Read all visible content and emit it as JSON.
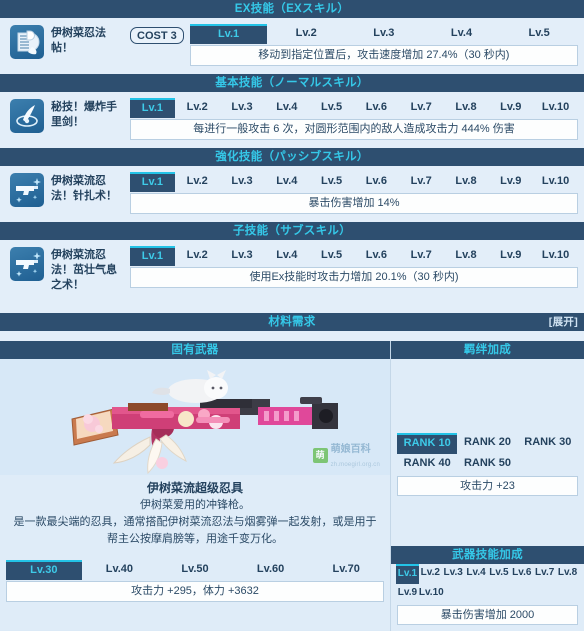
{
  "sections": {
    "ex": {
      "title": "EX技能（EXスキル）"
    },
    "normal": {
      "title": "基本技能（ノーマルスキル）"
    },
    "passive": {
      "title": "強化技能（パッシブスキル）"
    },
    "sub": {
      "title": "子技能（サブスキル）"
    },
    "material": {
      "title": "材料需求",
      "expand_label": "[展开]"
    },
    "weapon": {
      "title": "固有武器"
    },
    "bond": {
      "title": "羁绊加成"
    },
    "weapon_skill": {
      "title": "武器技能加成"
    }
  },
  "skills": [
    {
      "name": "伊树菜忍法帖！",
      "cost": "COST 3",
      "icon": "scroll-icon",
      "levels": [
        "Lv.1",
        "Lv.2",
        "Lv.3",
        "Lv.4",
        "Lv.5"
      ],
      "active_level": 0,
      "description": "移动到指定位置后，攻击速度增加 27.4%（30 秒内)"
    },
    {
      "name": "秘技！爆炸手里剑！",
      "cost": "",
      "icon": "shuriken-icon",
      "levels": [
        "Lv.1",
        "Lv.2",
        "Lv.3",
        "Lv.4",
        "Lv.5",
        "Lv.6",
        "Lv.7",
        "Lv.8",
        "Lv.9",
        "Lv.10"
      ],
      "active_level": 0,
      "description": "每进行一般攻击 6 次，对圆形范围内的敌人造成攻击力 444% 伤害"
    },
    {
      "name": "伊树菜流忍法！针扎术！",
      "cost": "",
      "icon": "pistol-sparkle-icon",
      "levels": [
        "Lv.1",
        "Lv.2",
        "Lv.3",
        "Lv.4",
        "Lv.5",
        "Lv.6",
        "Lv.7",
        "Lv.8",
        "Lv.9",
        "Lv.10"
      ],
      "active_level": 0,
      "description": "暴击伤害增加 14%"
    },
    {
      "name": "伊树菜流忍法！茁壮气息之术！",
      "cost": "",
      "icon": "pistol-sparkle-icon",
      "levels": [
        "Lv.1",
        "Lv.2",
        "Lv.3",
        "Lv.4",
        "Lv.5",
        "Lv.6",
        "Lv.7",
        "Lv.8",
        "Lv.9",
        "Lv.10"
      ],
      "active_level": 0,
      "description": "使用Ex技能时攻击力增加 20.1%（30 秒内)"
    }
  ],
  "weapon": {
    "name": "伊树菜流超级忍具",
    "subtitle": "伊树菜爱用的冲锋枪。",
    "description": "是一款最尖端的忍具，通常搭配伊树菜流忍法与烟雾弹一起发射，或是用于帮主公按摩肩膀等，用途千变万化。",
    "levels": [
      "Lv.30",
      "Lv.40",
      "Lv.50",
      "Lv.60",
      "Lv.70"
    ],
    "active_level": 0,
    "stats": "攻击力 +295，体力 +3632"
  },
  "bond": {
    "ranks": [
      "RANK 10",
      "RANK 20",
      "RANK 30",
      "RANK 40",
      "RANK 50"
    ],
    "active_rank": 0,
    "effect": "攻击力 +23"
  },
  "weapon_skill": {
    "levels": [
      "Lv.1",
      "Lv.2",
      "Lv.3",
      "Lv.4",
      "Lv.5",
      "Lv.6",
      "Lv.7",
      "Lv.8",
      "Lv.9",
      "Lv.10"
    ],
    "active_level": 0,
    "effect": "暴击伤害增加 2000"
  },
  "watermark": {
    "badge": "萌",
    "text": "萌娘百科",
    "url": "zh.moegirl.org.cn"
  },
  "colors": {
    "header_bg": "#2e4f70",
    "header_text": "#35c8e8",
    "panel_bg": "#dfecf8",
    "accent": "#23c3e7"
  }
}
